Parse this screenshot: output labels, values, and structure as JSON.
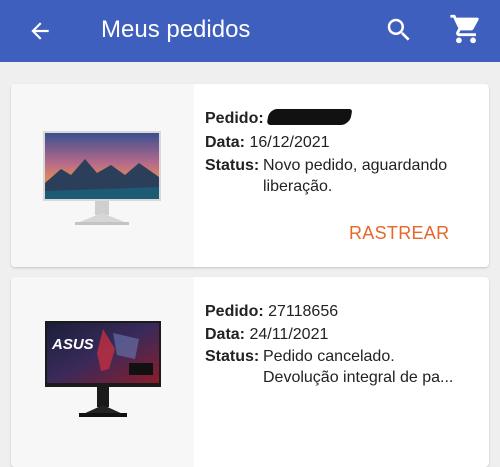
{
  "header": {
    "title": "Meus pedidos"
  },
  "colors": {
    "appbar": "#3e5fbd",
    "accent": "#e5682a",
    "background": "#efefef"
  },
  "orders": [
    {
      "order_label": "Pedido:",
      "order_number": "",
      "order_number_redacted": true,
      "date_label": "Data:",
      "date": "16/12/2021",
      "status_label": "Status:",
      "status_line1": "Novo pedido, aguardando",
      "status_line2": "liberação.",
      "action_label": "RASTREAR",
      "product_image": "lg-monitor-image"
    },
    {
      "order_label": "Pedido:",
      "order_number": "27118656",
      "date_label": "Data:",
      "date": "24/11/2021",
      "status_label": "Status:",
      "status_line1": "Pedido cancelado.",
      "status_line2": "Devolução integral de pa...",
      "product_image": "asus-monitor-image",
      "brand_text": "ASUS"
    }
  ],
  "icons": {
    "back": "arrow-left-icon",
    "search": "search-icon",
    "cart": "cart-icon"
  }
}
